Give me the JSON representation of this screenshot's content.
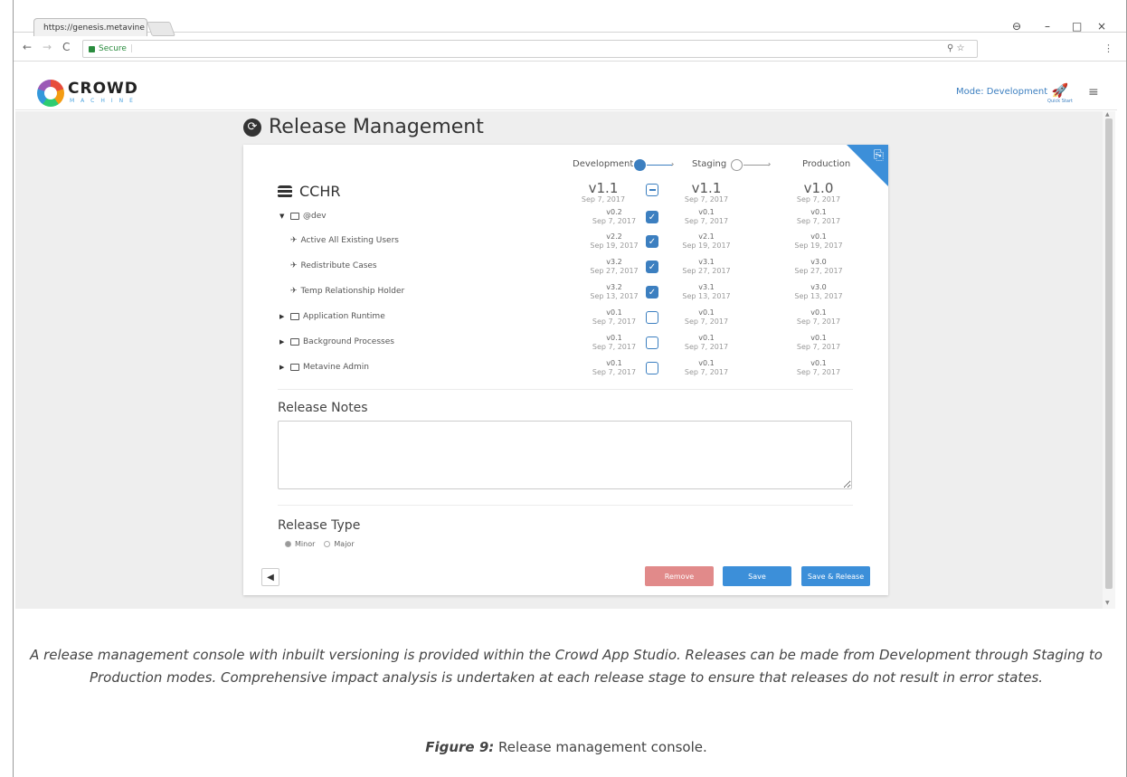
{
  "browser": {
    "tab_title": "https://genesis.metavine",
    "tab_close": "×",
    "url_secure_label": "Secure",
    "window_controls": [
      "⊖",
      "–",
      "□",
      "×"
    ]
  },
  "header": {
    "logo_text": "CROWD",
    "logo_sub": "MACHINE",
    "mode_label": "Mode: Development",
    "quick_start_label": "Quick Start"
  },
  "page": {
    "title": "Release Management",
    "stages": [
      "Development",
      "Staging",
      "Production"
    ],
    "app_name": "CCHR",
    "app_versions": {
      "development": {
        "version": "v1.1",
        "date": "Sep 7, 2017"
      },
      "staging": {
        "version": "v1.1",
        "date": "Sep 7, 2017"
      },
      "production": {
        "version": "v1.0",
        "date": "Sep 7, 2017"
      }
    },
    "rows": [
      {
        "name": "@dev",
        "kind": "folder",
        "expanded": true,
        "dev_v": "v0.2",
        "dev_d": "Sep 7, 2017",
        "stg_v": "v0.1",
        "stg_d": "Sep 7, 2017",
        "prd_v": "v0.1",
        "prd_d": "Sep 7, 2017",
        "checked": true
      },
      {
        "name": "Active All Existing Users",
        "kind": "process",
        "dev_v": "v2.2",
        "dev_d": "Sep 19, 2017",
        "stg_v": "v2.1",
        "stg_d": "Sep 19, 2017",
        "prd_v": "v0.1",
        "prd_d": "Sep 19, 2017",
        "checked": true
      },
      {
        "name": "Redistribute Cases",
        "kind": "process",
        "dev_v": "v3.2",
        "dev_d": "Sep 27, 2017",
        "stg_v": "v3.1",
        "stg_d": "Sep 27, 2017",
        "prd_v": "v3.0",
        "prd_d": "Sep 27, 2017",
        "checked": true
      },
      {
        "name": "Temp Relationship Holder",
        "kind": "process",
        "dev_v": "v3.2",
        "dev_d": "Sep 13, 2017",
        "stg_v": "v3.1",
        "stg_d": "Sep 13, 2017",
        "prd_v": "v3.0",
        "prd_d": "Sep 13, 2017",
        "checked": true
      },
      {
        "name": "Application Runtime",
        "kind": "folder",
        "expanded": false,
        "dev_v": "v0.1",
        "dev_d": "Sep 7, 2017",
        "stg_v": "v0.1",
        "stg_d": "Sep 7, 2017",
        "prd_v": "v0.1",
        "prd_d": "Sep 7, 2017",
        "checked": false
      },
      {
        "name": "Background Processes",
        "kind": "folder",
        "expanded": false,
        "dev_v": "v0.1",
        "dev_d": "Sep 7, 2017",
        "stg_v": "v0.1",
        "stg_d": "Sep 7, 2017",
        "prd_v": "v0.1",
        "prd_d": "Sep 7, 2017",
        "checked": false
      },
      {
        "name": "Metavine Admin",
        "kind": "folder",
        "expanded": false,
        "dev_v": "v0.1",
        "dev_d": "Sep 7, 2017",
        "stg_v": "v0.1",
        "stg_d": "Sep 7, 2017",
        "prd_v": "v0.1",
        "prd_d": "Sep 7, 2017",
        "checked": false
      }
    ],
    "release_notes_label": "Release Notes",
    "release_notes_value": "",
    "release_type_label": "Release Type",
    "release_type_options": [
      "Minor",
      "Major"
    ],
    "release_type_selected": "Minor",
    "buttons": {
      "remove": "Remove",
      "save": "Save",
      "save_release": "Save & Release"
    }
  },
  "caption": {
    "text": "A release management console with inbuilt versioning is provided within the Crowd App Studio. Releases can be made from Development through Staging to Production modes. Comprehensive impact analysis is undertaken at each release stage to ensure that releases do not result in error states.",
    "figure_label": "Figure 9:",
    "figure_text": "Release management console."
  },
  "colors": {
    "accent": "#3c8fd9",
    "remove": "#e18a8a",
    "page_bg": "#eeeeee"
  }
}
